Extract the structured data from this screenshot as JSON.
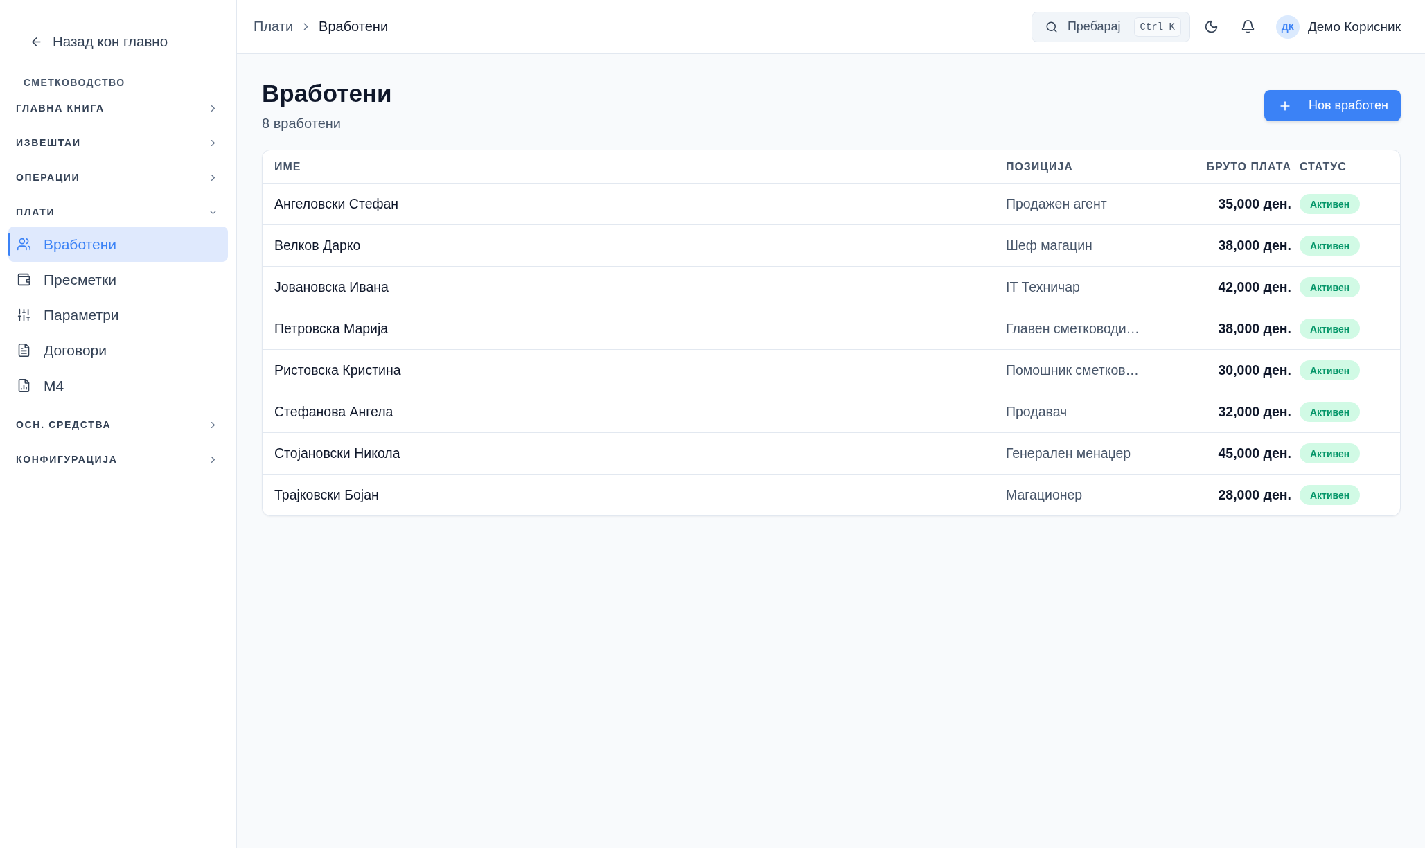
{
  "sidebar": {
    "back_link": "Назад кон главно",
    "section_title": "СМЕТКОВОДСТВО",
    "groups": [
      {
        "label": "ГЛАВНА КНИГА",
        "expanded": false
      },
      {
        "label": "ИЗВЕШТАИ",
        "expanded": false
      },
      {
        "label": "ОПЕРАЦИИ",
        "expanded": false
      },
      {
        "label": "ПЛАТИ",
        "expanded": true,
        "items": [
          {
            "label": "Вработени",
            "selected": true
          },
          {
            "label": "Пресметки",
            "selected": false
          },
          {
            "label": "Параметри",
            "selected": false
          },
          {
            "label": "Договори",
            "selected": false
          },
          {
            "label": "М4",
            "selected": false
          }
        ]
      },
      {
        "label": "ОСН. СРЕДСТВА",
        "expanded": false
      },
      {
        "label": "КОНФИГУРАЦИЈА",
        "expanded": false
      }
    ]
  },
  "topbar": {
    "breadcrumb": [
      {
        "label": "Плати",
        "current": false
      },
      {
        "label": "Вработени",
        "current": true
      }
    ],
    "search": {
      "placeholder": "Пребарај",
      "shortcut": "Ctrl K"
    },
    "user": {
      "initials": "ДК",
      "name": "Демо Корисник"
    }
  },
  "page": {
    "title": "Вработени",
    "subtitle": "8 вработени",
    "primary_button": "Нов вработен"
  },
  "table": {
    "columns": [
      "ИМЕ",
      "ПОЗИЦИЈА",
      "БРУТО ПЛАТА",
      "СТАТУС"
    ],
    "rows": [
      {
        "name": "Ангеловски Стефан",
        "position": "Продажен агент",
        "gross_salary": "35,000 ден.",
        "status": "Активен"
      },
      {
        "name": "Велков Дарко",
        "position": "Шеф магацин",
        "gross_salary": "38,000 ден.",
        "status": "Активен"
      },
      {
        "name": "Јовановска Ивана",
        "position": "IT Техничар",
        "gross_salary": "42,000 ден.",
        "status": "Активен"
      },
      {
        "name": "Петровска Марија",
        "position": "Главен сметководи…",
        "gross_salary": "38,000 ден.",
        "status": "Активен"
      },
      {
        "name": "Ристовска Кристина",
        "position": "Помошник сметков…",
        "gross_salary": "30,000 ден.",
        "status": "Активен"
      },
      {
        "name": "Стефанова Ангела",
        "position": "Продавач",
        "gross_salary": "32,000 ден.",
        "status": "Активен"
      },
      {
        "name": "Стојановски Никола",
        "position": "Генерален менаџер",
        "gross_salary": "45,000 ден.",
        "status": "Активен"
      },
      {
        "name": "Трајковски Бојан",
        "position": "Магационер",
        "gross_salary": "28,000 ден.",
        "status": "Активен"
      }
    ]
  }
}
